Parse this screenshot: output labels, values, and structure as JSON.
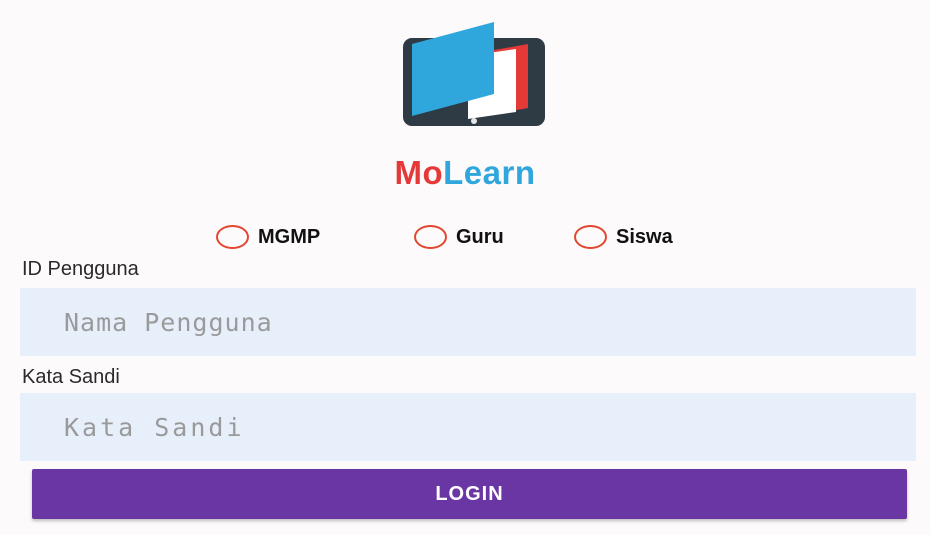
{
  "app": {
    "name_part1": "Mo",
    "name_part2": "Learn",
    "logo_icon": "tablet-book-icon",
    "colors": {
      "brand_red": "#e53938",
      "brand_blue": "#2fa6dc",
      "button_purple": "#6a36a3",
      "input_bg": "#e7effb",
      "radio_ring": "#e3462f"
    }
  },
  "role_options": [
    {
      "label": "MGMP",
      "selected": false
    },
    {
      "label": "Guru",
      "selected": false
    },
    {
      "label": "Siswa",
      "selected": false
    }
  ],
  "form": {
    "user_id_label": "ID Pengguna",
    "user_id_placeholder": "Nama Pengguna",
    "user_id_value": "",
    "password_label": "Kata Sandi",
    "password_placeholder": "Kata Sandi",
    "password_value": ""
  },
  "actions": {
    "login_label": "LOGIN"
  }
}
